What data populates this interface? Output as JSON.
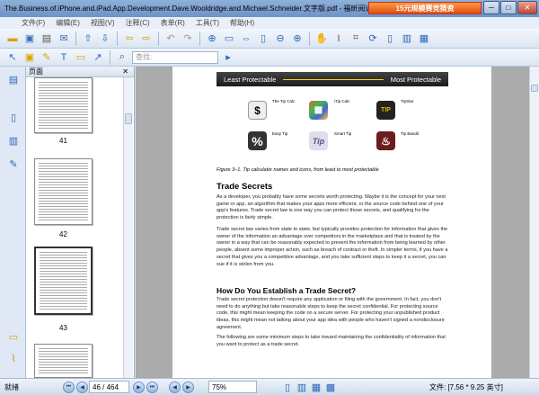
{
  "window": {
    "title": "The.Business.of.iPhone.and.iPad.App.Development.Dave.Wooldridge.and.Michael.Schneider.文字版.pdf - 福昕阅读器 - [The.Business.of.iPh...",
    "ad": "15元规模赛竞猜资",
    "min": "─",
    "max": "□",
    "close": "✕"
  },
  "menu": [
    "文件(F)",
    "编辑(E)",
    "视图(V)",
    "注释(C)",
    "表单(R)",
    "工具(T)",
    "帮助(H)"
  ],
  "toolbar": {
    "search_placeholder": "查找:"
  },
  "panel": {
    "title": "页面",
    "close": "✕"
  },
  "thumbnails": [
    {
      "label": "41"
    },
    {
      "label": "42"
    },
    {
      "label": "43"
    }
  ],
  "figure": {
    "band_left": "Least Protectable",
    "band_right": "Most Protectable",
    "apps": [
      {
        "icon": "$",
        "name": "The Tip Calc"
      },
      {
        "icon": "▦",
        "name": "iTip Calc"
      },
      {
        "icon": "TIP",
        "name": "TipStar"
      },
      {
        "icon": "%",
        "name": "Easy Tip"
      },
      {
        "icon": "Tip",
        "name": "Smart Tip"
      },
      {
        "icon": "♨",
        "name": "Tip Bandit"
      }
    ],
    "caption": "Figure 3–1. Tip calculator names and icons, from least to most protectable"
  },
  "doc": {
    "h1": "Trade Secrets",
    "p1": "As a developer, you probably have some secrets worth protecting. Maybe it is the concept for your next game or app, an algorithm that makes your apps more efficient, or the source code behind one of your app's features. Trade secret law is one way you can protect those secrets, and qualifying for the protection is fairly simple.",
    "p2": "Trade secret law varies from state to state, but typically provides protection for information that gives the owner of the information an advantage over competitors in the marketplace and that is treated by the owner in a way that can be reasonably expected to prevent the information from being learned by other people, absent some improper action, such as breach of contract or theft. In simpler terms, if you have a secret that gives you a competitive advantage, and you take sufficient steps to keep it a secret, you can sue if it is stolen from you.",
    "h2": "How Do You Establish a Trade Secret?",
    "p3": "Trade secret protection doesn't require any application or filing with the government. In fact, you don't need to do anything but take reasonable steps to keep the secret confidential. For protecting source code, this might mean keeping the code on a secure server. For protecting your unpublished product ideas, this might mean not talking about your app idea with people who haven't signed a nondisclosure agreement.",
    "p4": "The following are some minimum steps to take toward maintaining the confidentiality of information that you want to protect as a trade secret."
  },
  "status": {
    "ready": "就绪",
    "page": "46 / 464",
    "zoom": "75%",
    "size": "文件: [7.56 * 9.25 英寸]"
  }
}
